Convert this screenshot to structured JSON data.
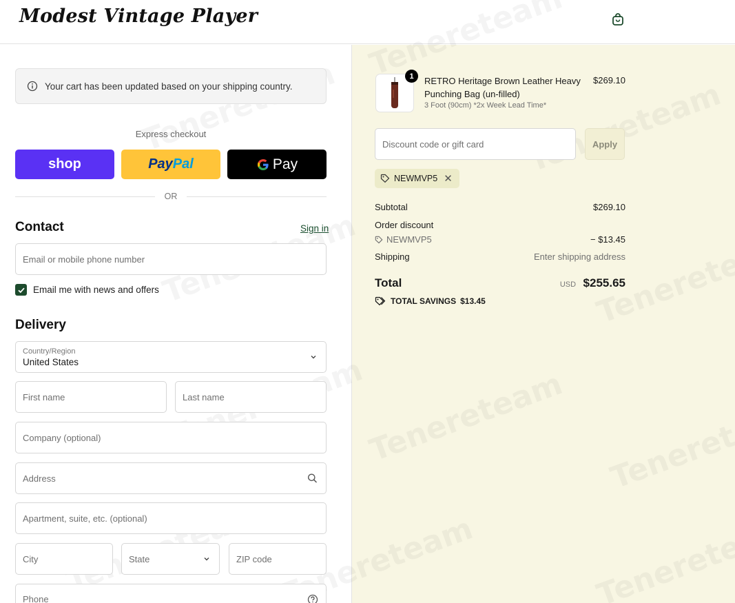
{
  "header": {
    "logo_text": "Modest Vintage Player",
    "cart_icon": "shopping-bag-icon"
  },
  "notice": {
    "icon": "info-icon",
    "text": "Your cart has been updated based on your shipping country."
  },
  "express": {
    "label": "Express checkout",
    "shop_label": "shop",
    "paypal_label_1": "Pay",
    "paypal_label_2": "Pal",
    "gpay_g": "G",
    "gpay_label": "Pay",
    "or_label": "OR"
  },
  "contact": {
    "title": "Contact",
    "sign_in": "Sign in",
    "email_placeholder": "Email or mobile phone number",
    "newsletter_label": "Email me with news and offers",
    "newsletter_checked": true
  },
  "delivery": {
    "title": "Delivery",
    "country_label": "Country/Region",
    "country_value": "United States",
    "first_name_placeholder": "First name",
    "last_name_placeholder": "Last name",
    "company_placeholder": "Company (optional)",
    "address_placeholder": "Address",
    "apartment_placeholder": "Apartment, suite, etc. (optional)",
    "city_placeholder": "City",
    "state_label": "State",
    "zip_placeholder": "ZIP code",
    "phone_placeholder": "Phone"
  },
  "order": {
    "product": {
      "quantity": "1",
      "name": "RETRO Heritage Brown Leather Heavy Punching Bag (un-filled)",
      "variant": "3 Foot (90cm) *2x Week Lead Time*",
      "price": "$269.10"
    },
    "discount_placeholder": "Discount code or gift card",
    "apply_label": "Apply",
    "applied_code": "NEWMVP5",
    "subtotal_label": "Subtotal",
    "subtotal_value": "$269.10",
    "order_discount_label": "Order discount",
    "discount_code": "NEWMVP5",
    "discount_value": "− $13.45",
    "shipping_label": "Shipping",
    "shipping_value": "Enter shipping address",
    "total_label": "Total",
    "currency": "USD",
    "total_value": "$255.65",
    "savings_label": "TOTAL SAVINGS",
    "savings_value": "$13.45"
  },
  "colors": {
    "shop_purple": "#5a31f4",
    "paypal_yellow": "#ffc439",
    "accent_green": "#1d4b2d",
    "summary_bg": "#f8f6e3"
  }
}
